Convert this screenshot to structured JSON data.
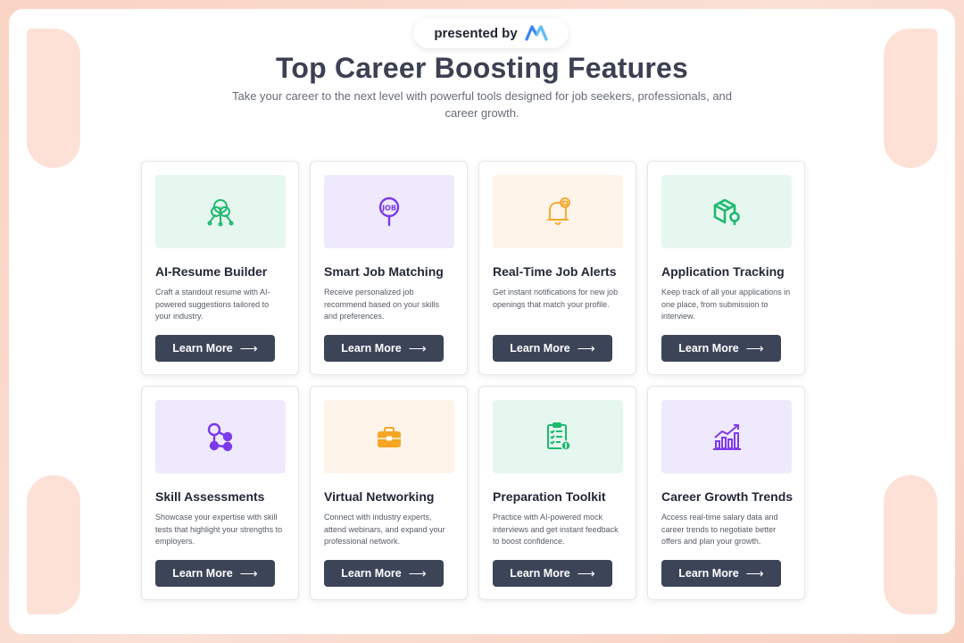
{
  "header": {
    "presented_by": "presented by",
    "title": "Top Career Boosting Features",
    "subtitle": "Take your career to the next level with powerful tools designed for job seekers, professionals, and career growth."
  },
  "colors": {
    "accent_dark": "#3c4458",
    "media_green": "#e6f7ef",
    "media_purple": "#efe9fd",
    "media_orange": "#fef4e9",
    "icon_green": "#1db96f",
    "icon_purple": "#7c3aed",
    "icon_orange": "#f5a623"
  },
  "cards": [
    {
      "title": "AI-Resume Builder",
      "desc": "Craft a standout resume with AI-powered suggestions tailored to your industry.",
      "button": "Learn More",
      "icon": "ai-brain-icon"
    },
    {
      "title": "Smart Job Matching",
      "desc": "Receive personalized job recommend based on your skills and preferences.",
      "button": "Learn More",
      "icon": "job-search-icon"
    },
    {
      "title": "Real-Time Job Alerts",
      "desc": "Get instant notifications for new job openings that match your profile.",
      "button": "Learn More",
      "icon": "bell-icon"
    },
    {
      "title": "Application Tracking",
      "desc": "Keep track of all your applications in one place, from submission to interview.",
      "button": "Learn More",
      "icon": "package-tracking-icon"
    },
    {
      "title": "Skill Assessments",
      "desc": "Showcase your expertise with skill tests that highlight your strengths to employers.",
      "button": "Learn More",
      "icon": "network-nodes-icon"
    },
    {
      "title": "Virtual Networking",
      "desc": "Connect with industry experts, attend webinars, and expand your professional network.",
      "button": "Learn More",
      "icon": "briefcase-icon"
    },
    {
      "title": "Preparation Toolkit",
      "desc": "Practice with AI-powered mock interviews and get instant feedback to boost confidence.",
      "button": "Learn More",
      "icon": "clipboard-checklist-icon"
    },
    {
      "title": "Career Growth Trends",
      "desc": "Access real-time salary data and career trends to negotiate better offers and plan your growth.",
      "button": "Learn More",
      "icon": "growth-chart-icon"
    }
  ]
}
